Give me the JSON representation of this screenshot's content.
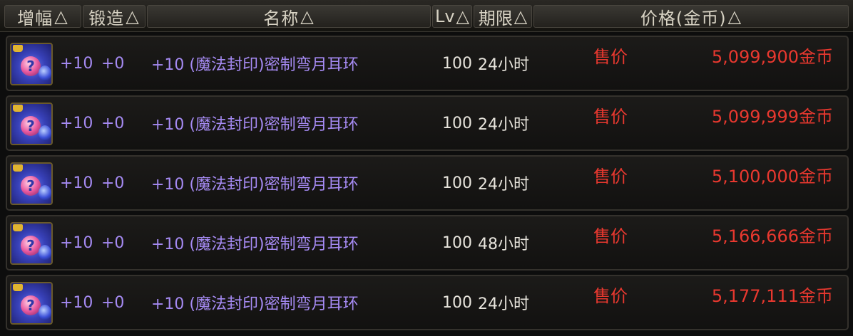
{
  "header": {
    "amp_label": "增幅",
    "forge_label": "锻造",
    "name_label": "名称",
    "lv_label": "Lv",
    "period_label": "期限",
    "price_label": "价格(金币)",
    "sort_icon": "△"
  },
  "rows": [
    {
      "icon": "sealed-earring-icon",
      "amp": "+10",
      "forge": "+0",
      "name": "+10 (魔法封印)密制弯月耳环",
      "level": "100",
      "period": "24小时",
      "sale_label": "售价",
      "price": "5,099,900金币"
    },
    {
      "icon": "sealed-earring-icon",
      "amp": "+10",
      "forge": "+0",
      "name": "+10 (魔法封印)密制弯月耳环",
      "level": "100",
      "period": "24小时",
      "sale_label": "售价",
      "price": "5,099,999金币"
    },
    {
      "icon": "sealed-earring-icon",
      "amp": "+10",
      "forge": "+0",
      "name": "+10 (魔法封印)密制弯月耳环",
      "level": "100",
      "period": "24小时",
      "sale_label": "售价",
      "price": "5,100,000金币"
    },
    {
      "icon": "sealed-earring-icon",
      "amp": "+10",
      "forge": "+0",
      "name": "+10 (魔法封印)密制弯月耳环",
      "level": "100",
      "period": "48小时",
      "sale_label": "售价",
      "price": "5,166,666金币"
    },
    {
      "icon": "sealed-earring-icon",
      "amp": "+10",
      "forge": "+0",
      "name": "+10 (魔法封印)密制弯月耳环",
      "level": "100",
      "period": "24小时",
      "sale_label": "售价",
      "price": "5,177,111金币"
    }
  ],
  "colors": {
    "name_purple": "#a58af2",
    "price_red": "#e8382f",
    "text_white": "#e7e4dc"
  }
}
